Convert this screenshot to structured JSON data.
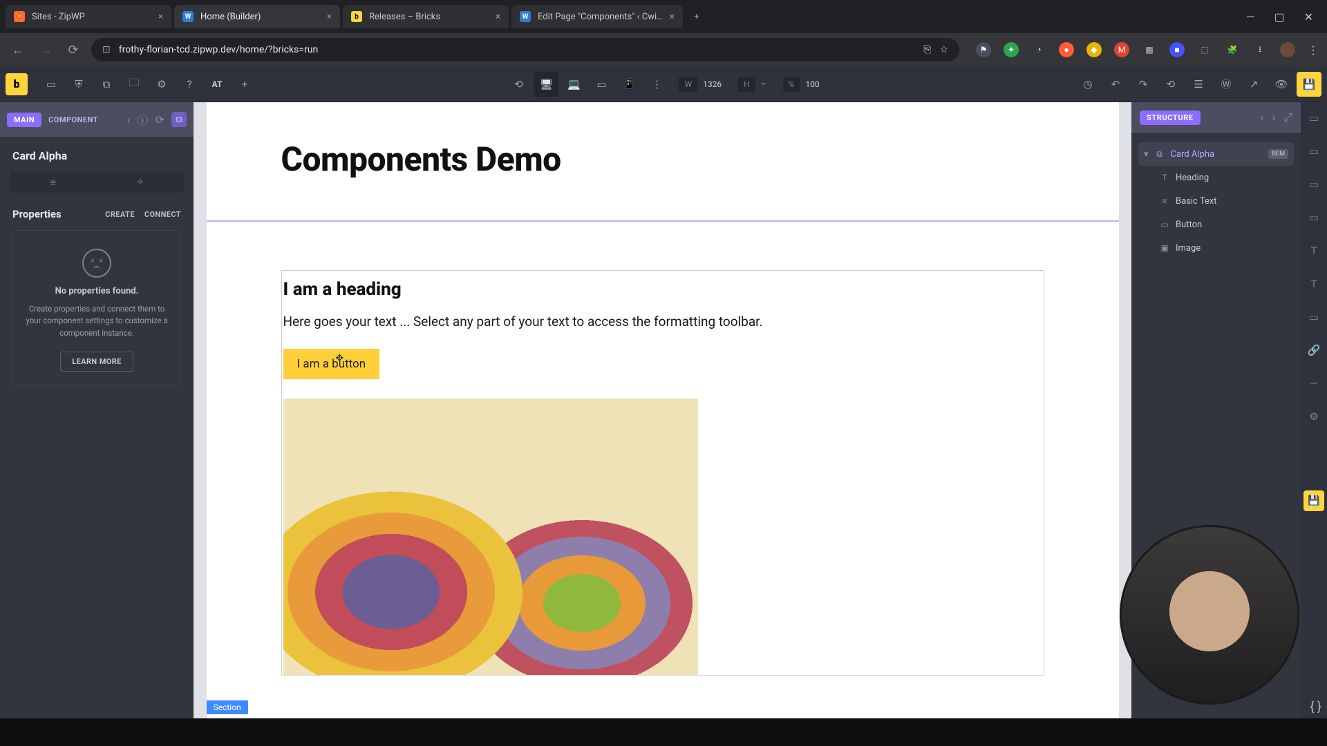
{
  "browser": {
    "tabs": [
      {
        "title": "Sites - ZipWP",
        "favicon_bg": "#ff6a2b",
        "favicon_txt": "•"
      },
      {
        "title": "Home (Builder)",
        "favicon_bg": "#2f7bd4",
        "favicon_txt": "W"
      },
      {
        "title": "Releases – Bricks",
        "favicon_bg": "#ffd53d",
        "favicon_txt": "b"
      },
      {
        "title": "Edit Page \"Components\" ‹ Cwi…",
        "favicon_bg": "#2f7bd4",
        "favicon_txt": "W"
      }
    ],
    "active_tab_index": 1,
    "url": "frothy-florian-tcd.zipwp.dev/home/?bricks=run"
  },
  "builder_toolbar": {
    "logo": "b",
    "at_label": "AT",
    "dims": {
      "w_label": "W",
      "w_value": "1326",
      "h_label": "H",
      "h_value": "–",
      "pct_label": "%",
      "pct_value": "100"
    }
  },
  "left_panel": {
    "pill_main": "MAIN",
    "pill_component": "COMPONENT",
    "title": "Card Alpha",
    "properties_label": "Properties",
    "create_label": "CREATE",
    "connect_label": "CONNECT",
    "no_props_title": "No properties found.",
    "no_props_hint": "Create properties and connect them to your component settings to customize a component instance.",
    "learn_more": "LEARN MORE"
  },
  "canvas": {
    "page_title": "Components Demo",
    "card_heading": "I am a heading",
    "card_text": "Here goes your text ... Select any part of your text to access the formatting toolbar.",
    "card_button": "I am a button",
    "section_tag": "Section"
  },
  "right_panel": {
    "pill_structure": "STRUCTURE",
    "root": {
      "label": "Card Alpha",
      "badge": "BEM"
    },
    "children": [
      {
        "icon": "T",
        "label": "Heading"
      },
      {
        "icon": "≡",
        "label": "Basic Text"
      },
      {
        "icon": "▭",
        "label": "Button"
      },
      {
        "icon": "▣",
        "label": "Image"
      }
    ]
  }
}
